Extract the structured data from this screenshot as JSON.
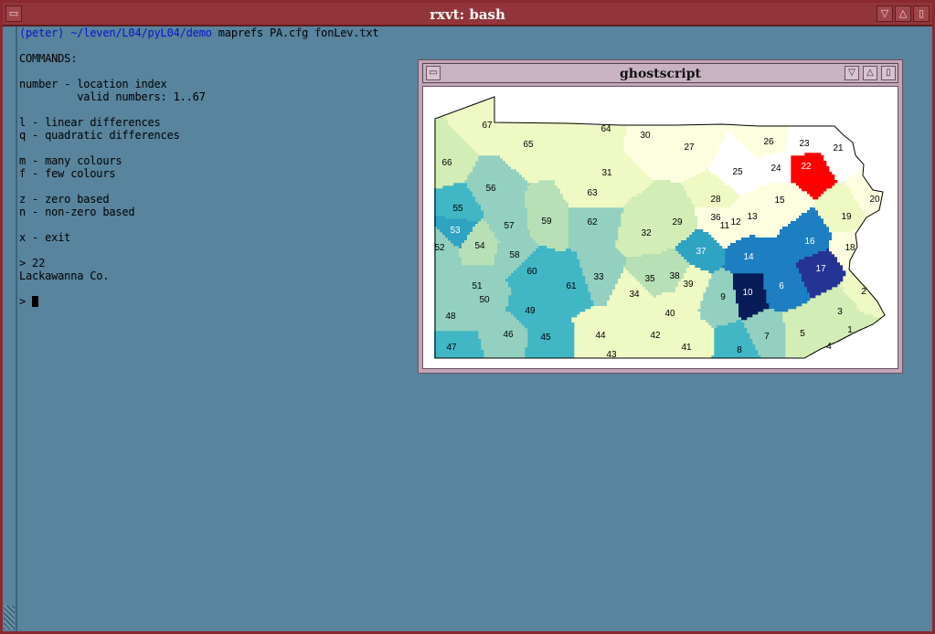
{
  "terminal_window": {
    "title": "rxvt: bash",
    "lines": [
      {
        "path": "(peter) ~/leven/L04/pyL04/demo",
        "text": " maprefs PA.cfg fonLev.txt"
      },
      {
        "text": ""
      },
      {
        "text": "COMMANDS:"
      },
      {
        "text": ""
      },
      {
        "text": "number - location index"
      },
      {
        "text": "         valid numbers: 1..67"
      },
      {
        "text": ""
      },
      {
        "text": "l - linear differences"
      },
      {
        "text": "q - quadratic differences"
      },
      {
        "text": ""
      },
      {
        "text": "m - many colours"
      },
      {
        "text": "f - few colours"
      },
      {
        "text": ""
      },
      {
        "text": "z - zero based"
      },
      {
        "text": "n - non-zero based"
      },
      {
        "text": ""
      },
      {
        "text": "x - exit"
      },
      {
        "text": ""
      },
      {
        "text": "> 22"
      },
      {
        "text": "Lackawanna Co."
      },
      {
        "text": ""
      },
      {
        "text": "> ",
        "cursor": true
      }
    ]
  },
  "ghostscript_window": {
    "title": "ghostscript"
  },
  "map": {
    "selected_location": "22",
    "colors": {
      "selected": "#ff0000",
      "scale": [
        "#ffffff",
        "#fdfde0",
        "#eef9c4",
        "#d3edb7",
        "#b7e0b6",
        "#93d0c0",
        "#41b6c4",
        "#2fa3c2",
        "#1d7fc1",
        "#253494",
        "#081d58"
      ]
    },
    "regions": [
      {
        "id": "1",
        "level": 3
      },
      {
        "id": "2",
        "level": 2
      },
      {
        "id": "3",
        "level": 3
      },
      {
        "id": "4",
        "level": 3
      },
      {
        "id": "5",
        "level": 3
      },
      {
        "id": "6",
        "level": 8
      },
      {
        "id": "7",
        "level": 5
      },
      {
        "id": "8",
        "level": 6
      },
      {
        "id": "9",
        "level": 5
      },
      {
        "id": "10",
        "level": 10
      },
      {
        "id": "11",
        "level": 1
      },
      {
        "id": "12",
        "level": 1
      },
      {
        "id": "13",
        "level": 1
      },
      {
        "id": "14",
        "level": 8
      },
      {
        "id": "15",
        "level": 1
      },
      {
        "id": "16",
        "level": 8
      },
      {
        "id": "17",
        "level": 9
      },
      {
        "id": "18",
        "level": 1
      },
      {
        "id": "19",
        "level": 2
      },
      {
        "id": "20",
        "level": 1
      },
      {
        "id": "21",
        "level": 0
      },
      {
        "id": "22",
        "level": "selected"
      },
      {
        "id": "23",
        "level": 0
      },
      {
        "id": "24",
        "level": 0
      },
      {
        "id": "25",
        "level": 0
      },
      {
        "id": "26",
        "level": 1
      },
      {
        "id": "27",
        "level": 1
      },
      {
        "id": "28",
        "level": 2
      },
      {
        "id": "29",
        "level": 3
      },
      {
        "id": "30",
        "level": 1
      },
      {
        "id": "31",
        "level": 2
      },
      {
        "id": "32",
        "level": 3
      },
      {
        "id": "33",
        "level": 5
      },
      {
        "id": "34",
        "level": 2
      },
      {
        "id": "35",
        "level": 4
      },
      {
        "id": "36",
        "level": 1
      },
      {
        "id": "37",
        "level": 7
      },
      {
        "id": "38",
        "level": 4
      },
      {
        "id": "39",
        "level": 2
      },
      {
        "id": "40",
        "level": 2
      },
      {
        "id": "41",
        "level": 2
      },
      {
        "id": "42",
        "level": 2
      },
      {
        "id": "43",
        "level": 2
      },
      {
        "id": "44",
        "level": 2
      },
      {
        "id": "45",
        "level": 6
      },
      {
        "id": "46",
        "level": 5
      },
      {
        "id": "47",
        "level": 6
      },
      {
        "id": "48",
        "level": 5
      },
      {
        "id": "49",
        "level": 6
      },
      {
        "id": "50",
        "level": 5
      },
      {
        "id": "51",
        "level": 5
      },
      {
        "id": "52",
        "level": 5
      },
      {
        "id": "53",
        "level": 7
      },
      {
        "id": "54",
        "level": 4
      },
      {
        "id": "55",
        "level": 6
      },
      {
        "id": "56",
        "level": 5
      },
      {
        "id": "57",
        "level": 5
      },
      {
        "id": "58",
        "level": 5
      },
      {
        "id": "59",
        "level": 4
      },
      {
        "id": "60",
        "level": 6
      },
      {
        "id": "61",
        "level": 6
      },
      {
        "id": "62",
        "level": 5
      },
      {
        "id": "63",
        "level": 2
      },
      {
        "id": "64",
        "level": 2
      },
      {
        "id": "65",
        "level": 2
      },
      {
        "id": "66",
        "level": 3
      },
      {
        "id": "67",
        "level": 2
      }
    ]
  }
}
